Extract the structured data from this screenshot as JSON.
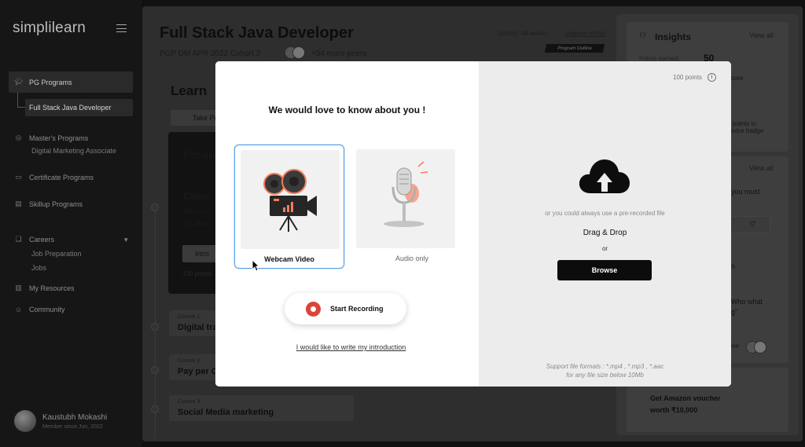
{
  "sidebar": {
    "logo": "simplilearn",
    "pg_programs": "PG Programs",
    "full_stack": "Full Stack Java Developer",
    "masters": "Master's Programs",
    "masters_sub": "Digital Marketing Associate",
    "certificate": "Certificate Programs",
    "skillup": "Skillup Programs",
    "careers": "Careers",
    "job_prep": "Job Preparation",
    "jobs": "Jobs",
    "my_resources": "My Resources",
    "community": "Community",
    "profile_name": "Kaustubh Mokashi",
    "profile_since": "Member since Jun, 2022"
  },
  "main": {
    "title": "Full Stack Java Developer",
    "cohort": "PGP DM APR 2022 Cohort 3",
    "peers": "+54 more peers",
    "validity": "Validity: 48 weeks",
    "change_cohort": "change cohort",
    "program_outline": "Program Outline",
    "learn": "Learn",
    "take_pre": "Take Pr",
    "prog_frag": "Progra",
    "conn_frag": "Conn",
    "you_can": "You can",
    "its_alwa": "Its alwa",
    "intro_btn": "Intro",
    "points_frag": "100 points",
    "courses": [
      {
        "label": "Course 1",
        "name": "Digital tra"
      },
      {
        "label": "Course 2",
        "name": "Pay per C"
      },
      {
        "label": "Course 3",
        "name": "Social Media marketing"
      }
    ]
  },
  "insights": {
    "title": "Insights",
    "view_all_1": "View all",
    "view_all_2": "View all",
    "points_earned": "Points earned:",
    "points_val": "50",
    "frag_core": "core",
    "frag_points_to": "l points to",
    "frag_badge": "ovice badge",
    "frag_you_must": "you must",
    "frag_n": "n",
    "frag_who": "Who what",
    "frag_g": "g\"",
    "frag_ive": "ive",
    "amazon": "Get Amazon voucher",
    "amazon_val": "worth ₹10,000"
  },
  "modal": {
    "title": "We would love to know about you !",
    "webcam_label": "Webcam Video",
    "audio_label": "Audio only",
    "start_recording": "Start Recording",
    "write_intro": "I would like to write my introduction",
    "points": "100 points",
    "prerecorded": "or you could always use a pre-recorded file",
    "drag_drop": "Drag & Drop",
    "or": "or",
    "browse": "Browse",
    "support_1": "Support file formats : *.mp4 , *.mp3 , *.aac",
    "support_2": "for any file size below 10Mb"
  },
  "colors": {
    "accent_orange": "#f47c5b",
    "record_red": "#d8453b",
    "selected_border": "#5b9fe0"
  }
}
